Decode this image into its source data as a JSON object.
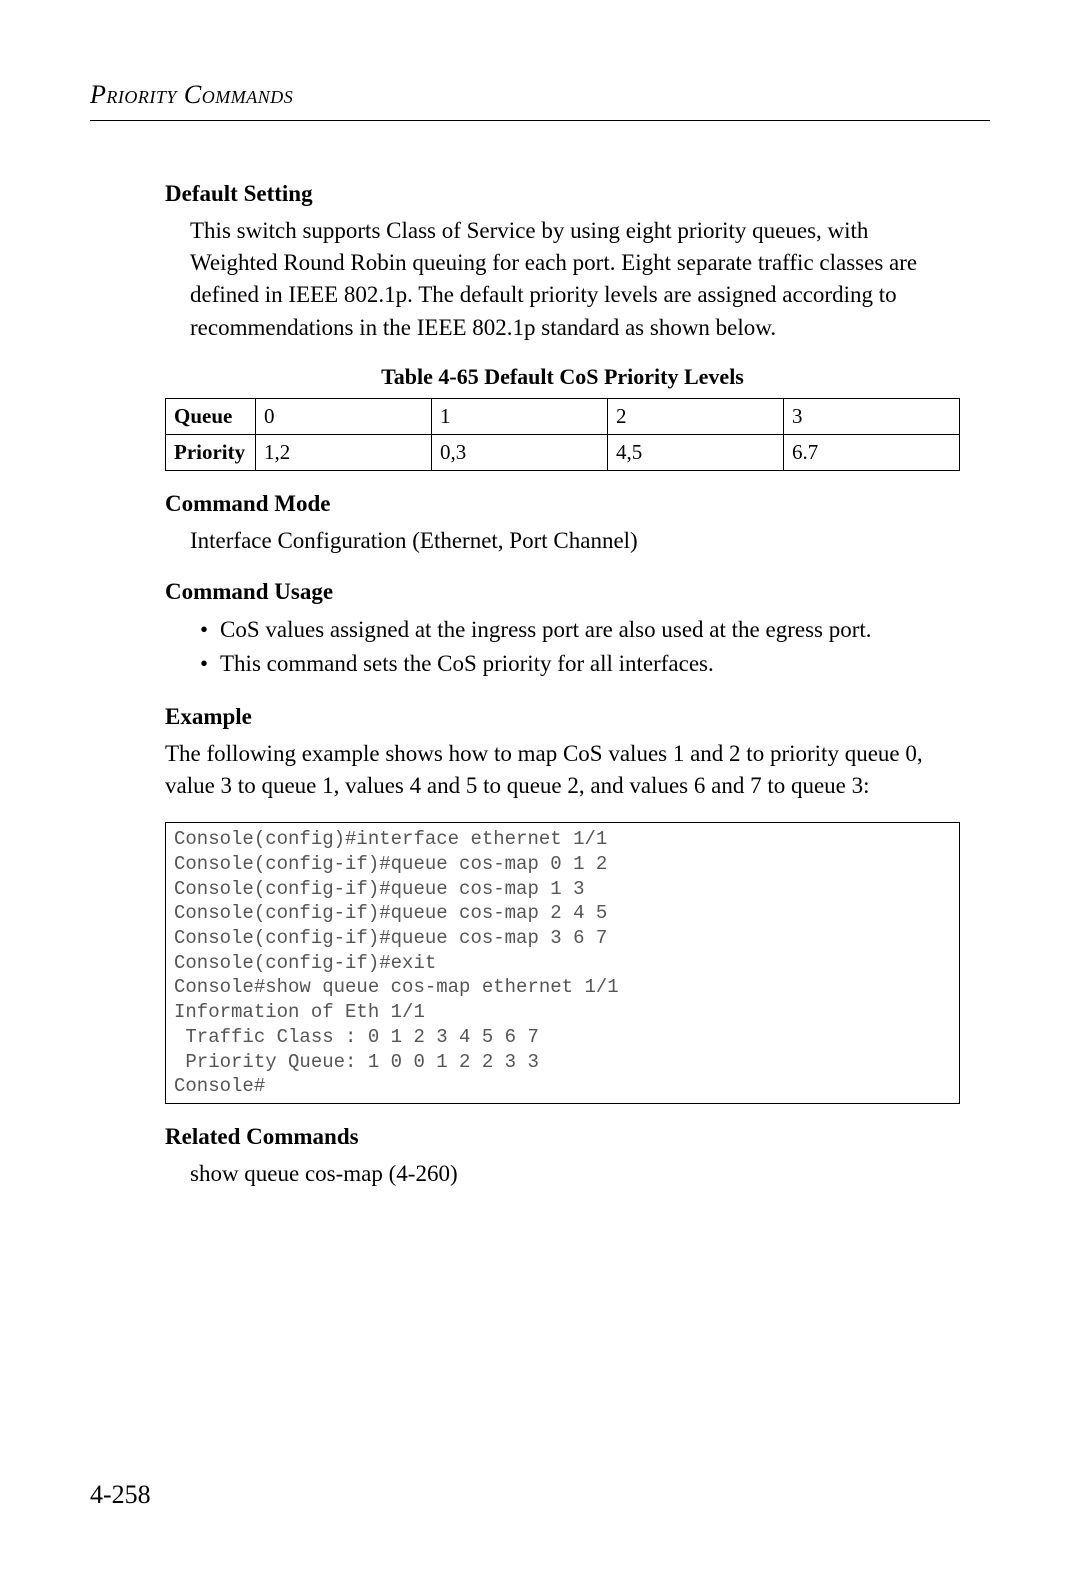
{
  "header": "Priority Commands",
  "sections": {
    "defaultSetting": {
      "heading": "Default Setting",
      "text": "This switch supports Class of Service by using eight priority queues, with Weighted Round Robin queuing for each port. Eight separate traffic classes are defined in IEEE 802.1p. The default priority levels are assigned according to recommendations in the IEEE 802.1p standard as shown below."
    },
    "tableCaption": "Table 4-65   Default CoS Priority Levels",
    "table": {
      "rows": [
        {
          "label": "Queue",
          "c0": "0",
          "c1": "1",
          "c2": "2",
          "c3": "3"
        },
        {
          "label": "Priority",
          "c0": "1,2",
          "c1": "0,3",
          "c2": "4,5",
          "c3": "6.7"
        }
      ]
    },
    "commandMode": {
      "heading": "Command Mode",
      "text": "Interface Configuration (Ethernet, Port Channel)"
    },
    "commandUsage": {
      "heading": "Command Usage",
      "items": [
        "CoS values assigned at the ingress port are also used at the egress port.",
        "This command sets the CoS priority for all interfaces."
      ]
    },
    "example": {
      "heading": "Example",
      "text": "The following example shows how to map CoS values 1 and 2 to priority queue 0, value 3 to queue 1, values 4 and 5 to queue 2, and values 6 and 7 to queue 3:",
      "code": "Console(config)#interface ethernet 1/1\nConsole(config-if)#queue cos-map 0 1 2\nConsole(config-if)#queue cos-map 1 3\nConsole(config-if)#queue cos-map 2 4 5\nConsole(config-if)#queue cos-map 3 6 7\nConsole(config-if)#exit\nConsole#show queue cos-map ethernet 1/1\nInformation of Eth 1/1\n Traffic Class : 0 1 2 3 4 5 6 7\n Priority Queue: 1 0 0 1 2 2 3 3\nConsole#"
    },
    "related": {
      "heading": "Related Commands",
      "text": "show queue cos-map (4-260)"
    }
  },
  "pageNumber": "4-258",
  "chart_data": {
    "type": "table",
    "title": "Table 4-65 Default CoS Priority Levels",
    "columns": [
      "Queue",
      "0",
      "1",
      "2",
      "3"
    ],
    "rows": [
      [
        "Priority",
        "1,2",
        "0,3",
        "4,5",
        "6.7"
      ]
    ]
  }
}
